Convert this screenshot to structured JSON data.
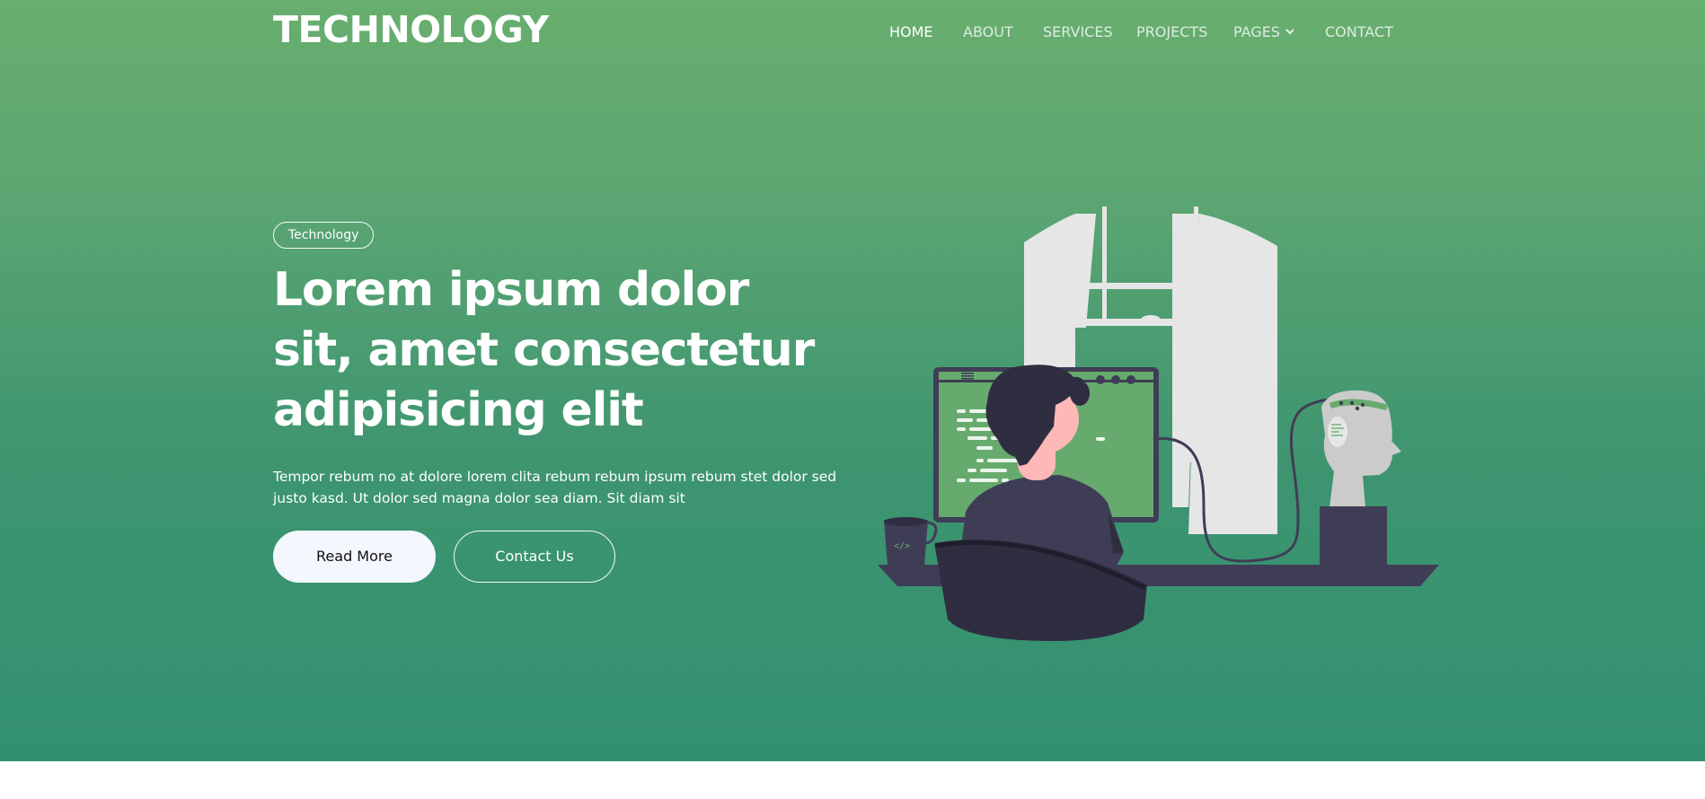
{
  "brand": "TECHNOLOGY",
  "nav": {
    "items": [
      {
        "label": "HOME",
        "active": true
      },
      {
        "label": "ABOUT",
        "active": false
      },
      {
        "label": "SERVICES",
        "active": false
      },
      {
        "label": "PROJECTS",
        "active": false
      },
      {
        "label": "PAGES",
        "active": false,
        "icon": "chevron-down-icon"
      },
      {
        "label": "CONTACT",
        "active": false
      }
    ]
  },
  "hero": {
    "tag": "Technology",
    "headline_lines": [
      "Lorem ipsum dolor",
      "sit, amet consectetur",
      "adipisicing elit"
    ],
    "lead_lines": [
      "Tempor rebum no at dolore lorem clita rebum rebum ipsum rebum stet dolor sed",
      "justo kasd. Ut dolor sed magna dolor sea diam. Sit diam sit"
    ],
    "primary_button": "Read More",
    "secondary_button": "Contact Us",
    "illustration": "person-coding-at-computer-illustration"
  },
  "colors": {
    "hero_top": "#68ae6e",
    "hero_bottom": "#329070",
    "screen_green": "#66ab6d",
    "dark_navy": "#3f3d56",
    "light_gray": "#e6e6e6",
    "skin": "#ffb8b8",
    "button_light": "#f4f7fd"
  }
}
